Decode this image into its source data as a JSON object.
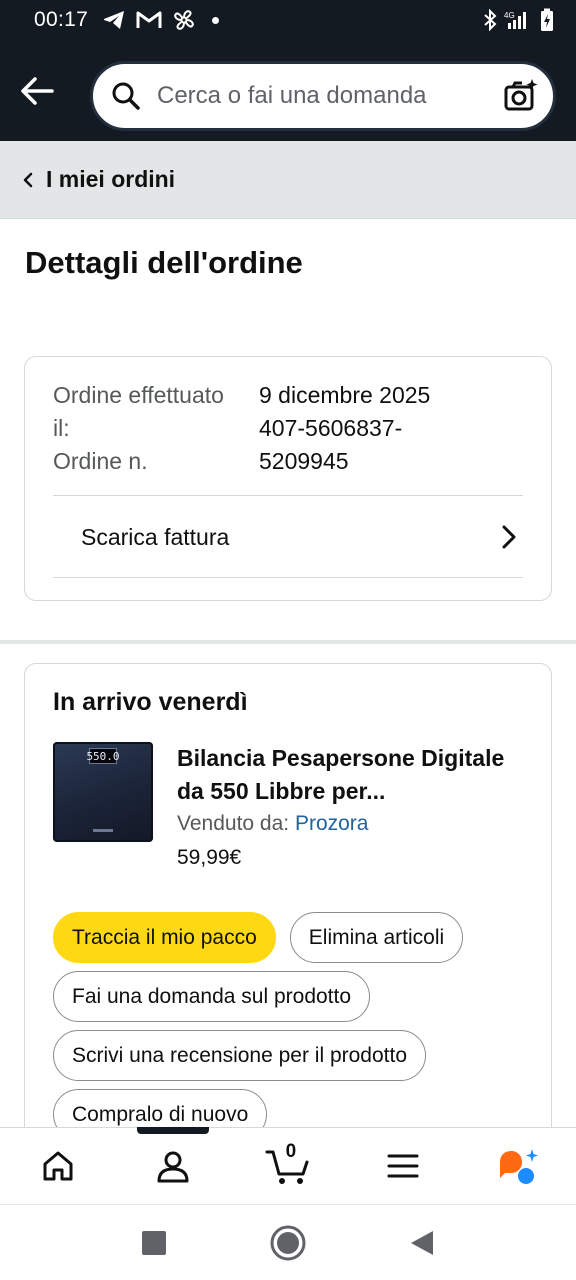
{
  "status_bar": {
    "time": "00:17",
    "network": "4G"
  },
  "search": {
    "placeholder": "Cerca o fai una domanda"
  },
  "breadcrumb": {
    "label": "I miei ordini"
  },
  "page": {
    "title": "Dettagli dell'ordine"
  },
  "order_info": {
    "placed_label": "Ordine effettuato il:",
    "placed_value": "9 dicembre 2025",
    "number_label": "Ordine n.",
    "number_value": "407-5606837-5209945",
    "invoice_label": "Scarica fattura"
  },
  "shipment": {
    "status": "In arrivo venerdì",
    "product": {
      "name": "Bilancia Pesapersone Digitale da 550 Libbre per...",
      "seller_prefix": "Venduto da: ",
      "seller": "Prozora",
      "price": "59,99€",
      "display_text": "550.0"
    },
    "buttons": {
      "track": "Traccia il mio pacco",
      "delete": "Elimina articoli",
      "ask": "Fai una domanda sul prodotto",
      "review": "Scrivi una recensione per il prodotto",
      "buy_again": "Compralo di nuovo"
    }
  },
  "bottom_nav": {
    "cart_count": "0"
  },
  "colors": {
    "header_bg": "#131a22",
    "primary_button": "#ffd814",
    "link": "#2162a1",
    "rufus_orange": "#ff6a13",
    "rufus_blue": "#1a8cff"
  }
}
